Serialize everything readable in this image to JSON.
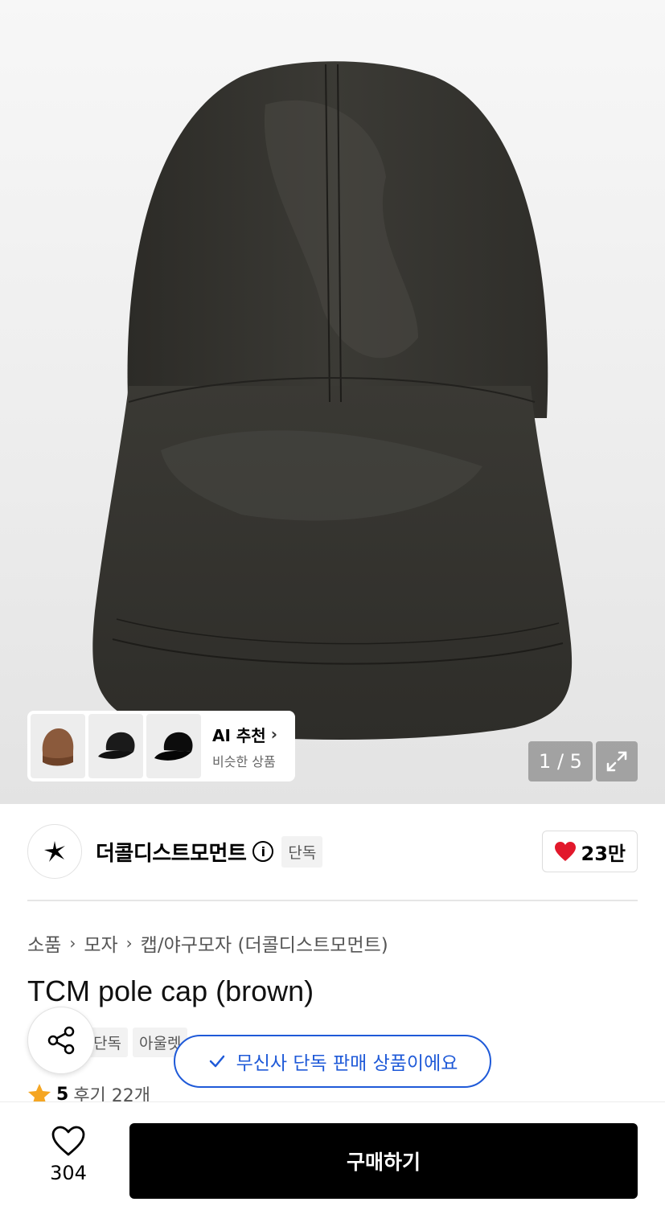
{
  "gallery": {
    "counter": "1 / 5",
    "expand_icon": "expand-icon"
  },
  "ai_recommend": {
    "title": "AI 추천",
    "subtitle": "비슷한 상품",
    "thumbnails": [
      "brown-cap",
      "black-cap",
      "black-cap"
    ]
  },
  "brand": {
    "name": "더콜디스트모먼트",
    "info_icon": "i",
    "badge": "단독",
    "likes": "23만",
    "like_color": "#e2182b"
  },
  "breadcrumb": [
    "소품",
    "모자",
    "캡/야구모자 (더콜디스트모먼트)"
  ],
  "product": {
    "title": "TCM pole cap (brown)",
    "tags": [
      "단독",
      "아울렛"
    ],
    "rating": "5",
    "reviews": "후기 22개",
    "star_color": "#f5a623"
  },
  "toast": {
    "message": "무신사 단독 판매 상품이에요",
    "accent": "#1f5ad8"
  },
  "bottom": {
    "wish_count": "304",
    "buy_label": "구매하기"
  }
}
